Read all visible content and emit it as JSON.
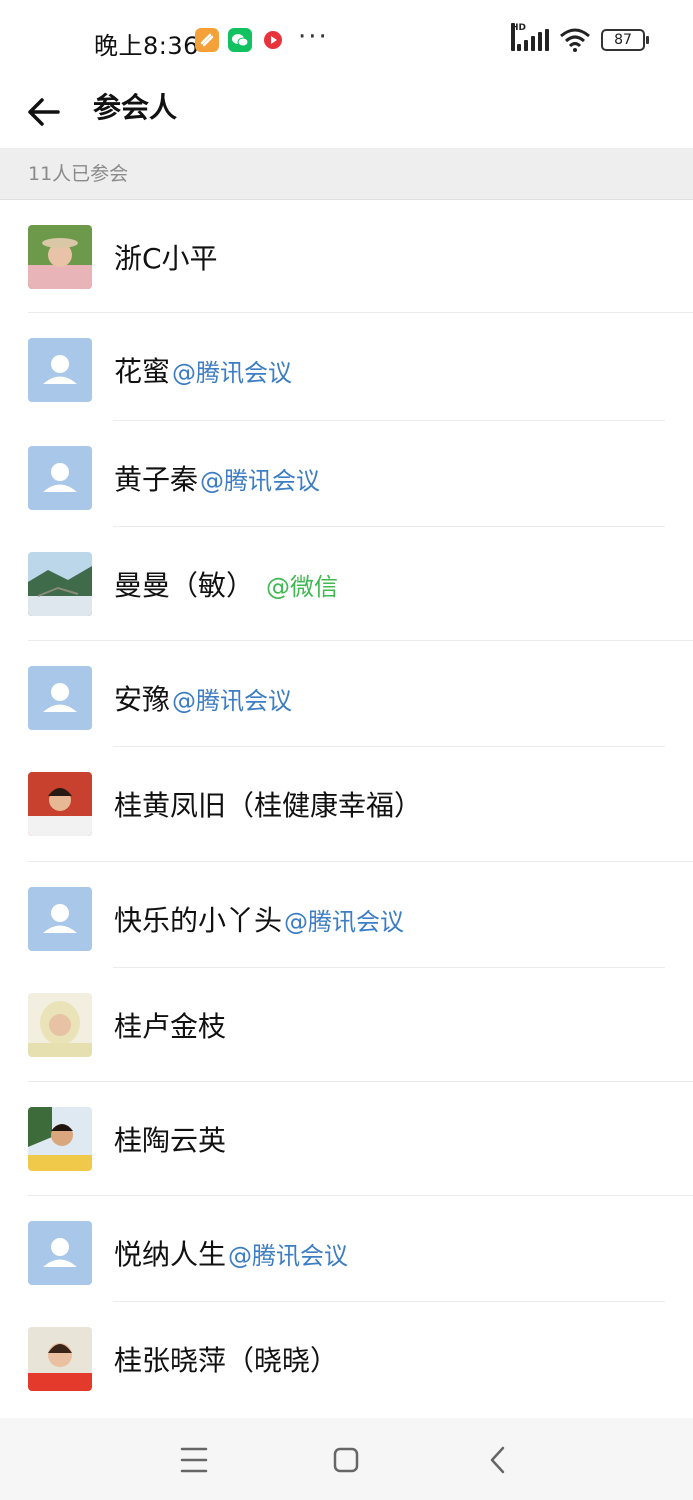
{
  "status_bar": {
    "time": "晚上8:36",
    "hd": "HD",
    "battery": "87",
    "more": "···"
  },
  "header": {
    "title": "参会人"
  },
  "section": {
    "count_label": "11人已参会"
  },
  "participants": [
    {
      "name": "浙C小平",
      "source": "",
      "avatar": "photo-pink"
    },
    {
      "name": "花蜜",
      "source": "@腾讯会议",
      "avatar": "default"
    },
    {
      "name": "黄子秦",
      "source": "@腾讯会议",
      "avatar": "default"
    },
    {
      "name": "曼曼（敏）",
      "source": "@微信",
      "avatar": "photo-landscape"
    },
    {
      "name": "安豫",
      "source": "@腾讯会议",
      "avatar": "default"
    },
    {
      "name": "桂黄凤旧（桂健康幸福）",
      "source": "",
      "avatar": "photo-red"
    },
    {
      "name": "快乐的小丫头",
      "source": "@腾讯会议",
      "avatar": "default"
    },
    {
      "name": "桂卢金枝",
      "source": "",
      "avatar": "photo-hood"
    },
    {
      "name": "桂陶云英",
      "source": "",
      "avatar": "photo-green"
    },
    {
      "name": "悦纳人生",
      "source": "@腾讯会议",
      "avatar": "default"
    },
    {
      "name": "桂张晓萍（晓晓）",
      "source": "",
      "avatar": "photo-red-shirt"
    }
  ],
  "colors": {
    "tencent_tag": "#3d7dc4",
    "wechat_tag": "#3fb950",
    "default_avatar": "#a9c7e8"
  }
}
